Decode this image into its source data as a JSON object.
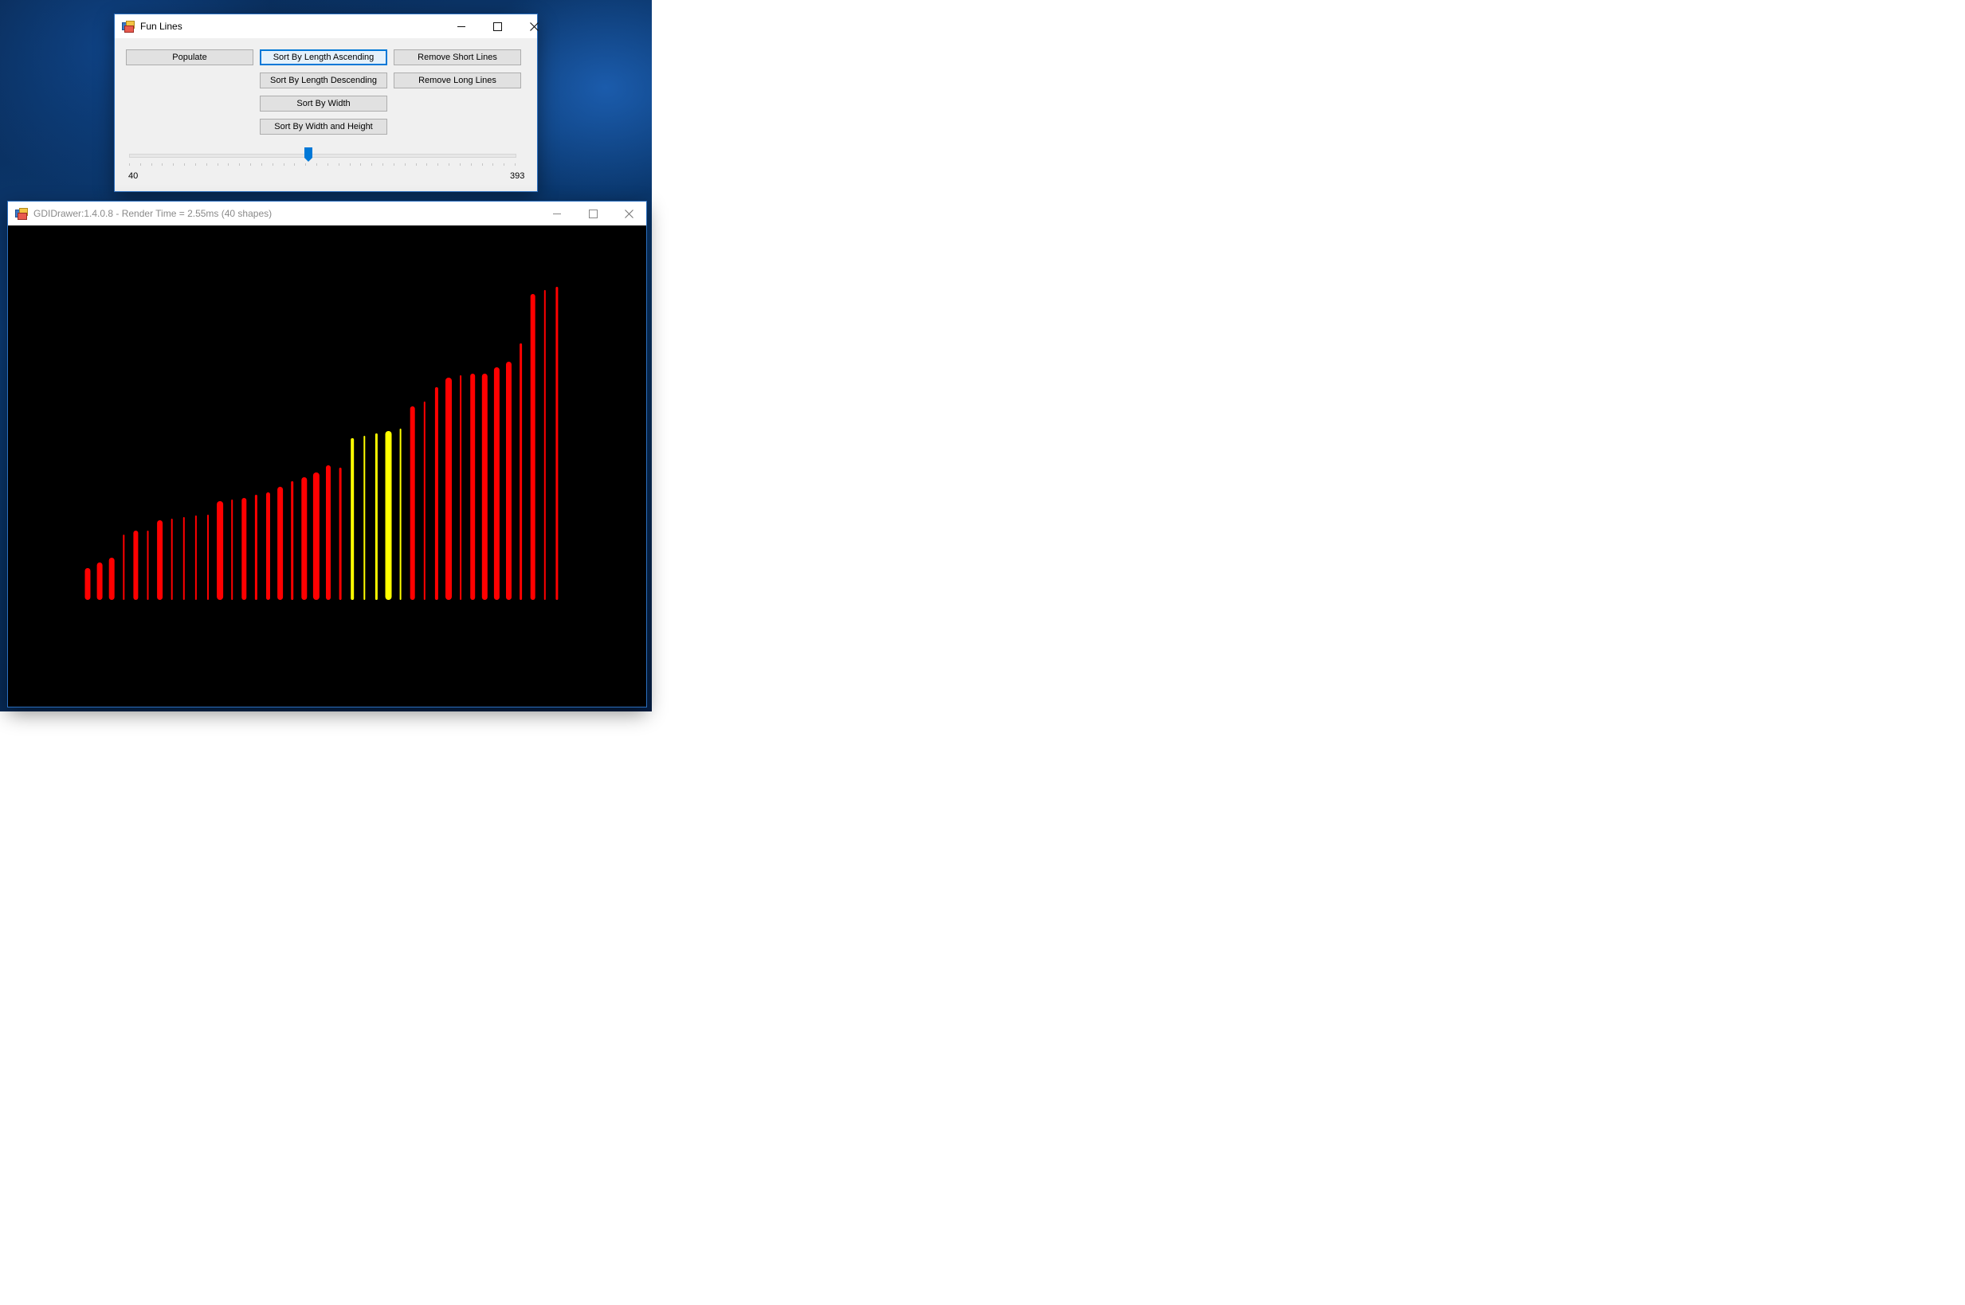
{
  "fun_lines_window": {
    "title": "Fun Lines",
    "buttons": {
      "populate": "Populate",
      "sort_length_asc": "Sort By Length Ascending",
      "remove_short": "Remove Short Lines",
      "sort_length_desc": "Sort By Length Descending",
      "remove_long": "Remove Long Lines",
      "sort_width": "Sort By Width",
      "sort_width_height": "Sort By Width and Height"
    },
    "slider": {
      "min_label": "40",
      "max_label": "393",
      "min": 40,
      "max": 393,
      "position_fraction": 0.465
    },
    "focused_button": "sort_length_asc"
  },
  "gdi_window": {
    "title": "GDIDrawer:1.4.0.8 - Render Time = 2.55ms (40 shapes)",
    "background_color": "#000000",
    "lines": [
      {
        "length": 40,
        "thickness": 7,
        "color": "#ff0000"
      },
      {
        "length": 47,
        "thickness": 7,
        "color": "#ff0000"
      },
      {
        "length": 53,
        "thickness": 7,
        "color": "#ff0000"
      },
      {
        "length": 82,
        "thickness": 2,
        "color": "#ff0000"
      },
      {
        "length": 87,
        "thickness": 6,
        "color": "#ff0000"
      },
      {
        "length": 87,
        "thickness": 2,
        "color": "#ff0000"
      },
      {
        "length": 100,
        "thickness": 7,
        "color": "#ff0000"
      },
      {
        "length": 102,
        "thickness": 2,
        "color": "#ff0000"
      },
      {
        "length": 104,
        "thickness": 2,
        "color": "#ff0000"
      },
      {
        "length": 106,
        "thickness": 2,
        "color": "#ff0000"
      },
      {
        "length": 107,
        "thickness": 2,
        "color": "#ff0000"
      },
      {
        "length": 124,
        "thickness": 8,
        "color": "#ff0000"
      },
      {
        "length": 126,
        "thickness": 2,
        "color": "#ff0000"
      },
      {
        "length": 128,
        "thickness": 6,
        "color": "#ff0000"
      },
      {
        "length": 132,
        "thickness": 3,
        "color": "#ff0000"
      },
      {
        "length": 135,
        "thickness": 5,
        "color": "#ff0000"
      },
      {
        "length": 142,
        "thickness": 7,
        "color": "#ff0000"
      },
      {
        "length": 149,
        "thickness": 3,
        "color": "#ff0000"
      },
      {
        "length": 154,
        "thickness": 7,
        "color": "#ff0000"
      },
      {
        "length": 160,
        "thickness": 8,
        "color": "#ff0000"
      },
      {
        "length": 169,
        "thickness": 6,
        "color": "#ff0000"
      },
      {
        "length": 166,
        "thickness": 3,
        "color": "#ff0000"
      },
      {
        "length": 203,
        "thickness": 4,
        "color": "#ffff00"
      },
      {
        "length": 206,
        "thickness": 2,
        "color": "#ffff00"
      },
      {
        "length": 209,
        "thickness": 3,
        "color": "#ffff00"
      },
      {
        "length": 212,
        "thickness": 8,
        "color": "#ffff00"
      },
      {
        "length": 215,
        "thickness": 2,
        "color": "#ffff00"
      },
      {
        "length": 243,
        "thickness": 6,
        "color": "#ff0000"
      },
      {
        "length": 249,
        "thickness": 2,
        "color": "#ff0000"
      },
      {
        "length": 267,
        "thickness": 4,
        "color": "#ff0000"
      },
      {
        "length": 279,
        "thickness": 8,
        "color": "#ff0000"
      },
      {
        "length": 282,
        "thickness": 2,
        "color": "#ff0000"
      },
      {
        "length": 284,
        "thickness": 6,
        "color": "#ff0000"
      },
      {
        "length": 284,
        "thickness": 7,
        "color": "#ff0000"
      },
      {
        "length": 292,
        "thickness": 7,
        "color": "#ff0000"
      },
      {
        "length": 299,
        "thickness": 7,
        "color": "#ff0000"
      },
      {
        "length": 322,
        "thickness": 3,
        "color": "#ff0000"
      },
      {
        "length": 384,
        "thickness": 6,
        "color": "#ff0000"
      },
      {
        "length": 389,
        "thickness": 2,
        "color": "#ff0000"
      },
      {
        "length": 393,
        "thickness": 3,
        "color": "#ff0000"
      }
    ]
  }
}
